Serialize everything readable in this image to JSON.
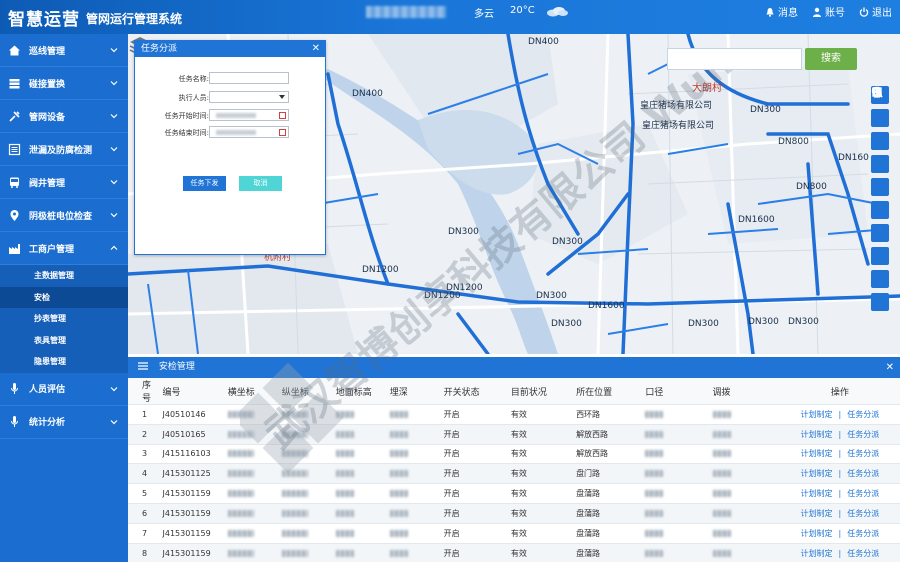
{
  "header": {
    "logo": "智慧运营",
    "subtitle": "管网运行管理系统",
    "weather": "多云",
    "temperature": "20°C",
    "messages": "消息",
    "account": "账号",
    "logout": "退出"
  },
  "sidebar": {
    "items": [
      {
        "label": "巡线管理",
        "icon": "home-icon"
      },
      {
        "label": "碰接置换",
        "icon": "stack-icon"
      },
      {
        "label": "管网设备",
        "icon": "tools-icon"
      },
      {
        "label": "泄漏及防腐检测",
        "icon": "list-icon"
      },
      {
        "label": "阀井管理",
        "icon": "bus-icon"
      },
      {
        "label": "阴极桩电位检查",
        "icon": "pin-icon"
      },
      {
        "label": "工商户管理",
        "icon": "factory-icon"
      }
    ],
    "sub_items": [
      "主数据管理",
      "安检",
      "抄表管理",
      "表具管理",
      "隐患管理"
    ],
    "bottom_items": [
      {
        "label": "人员评估",
        "icon": "mic-icon"
      },
      {
        "label": "统计分析",
        "icon": "mic-icon"
      }
    ]
  },
  "map": {
    "search_button": "搜索",
    "labels": [
      "DN400",
      "DN300",
      "DN300",
      "DN1200",
      "DN300",
      "DN1600",
      "DN300",
      "DN300",
      "DN300",
      "DN800",
      "DN300",
      "DN160",
      "DN800",
      "DN1600",
      "DN300",
      "DN1200",
      "DN400",
      "大朗村",
      "皇庄猪场有限公司",
      "皇庄猪场有限公司",
      "杭附村",
      "DN1200"
    ]
  },
  "dialog": {
    "title": "任务分派",
    "fields": {
      "name": "任务名称:",
      "executor": "执行人员:",
      "start": "任务开始时间:",
      "end": "任务结束时间:"
    },
    "submit": "任务下发",
    "cancel": "取消"
  },
  "panel": {
    "title": "安检管理",
    "columns": [
      "序号",
      "编号",
      "横坐标",
      "纵坐标",
      "地面标高",
      "埋深",
      "开关状态",
      "目前状况",
      "所在位置",
      "口径",
      "调拨",
      "操作"
    ],
    "rows": [
      {
        "no": "1",
        "code": "J40510146",
        "switch": "开启",
        "status": "有效",
        "location": "西环路"
      },
      {
        "no": "2",
        "code": "J40510165",
        "switch": "开启",
        "status": "有效",
        "location": "解放西路"
      },
      {
        "no": "3",
        "code": "J415116103",
        "switch": "开启",
        "status": "有效",
        "location": "解放西路"
      },
      {
        "no": "4",
        "code": "J415301125",
        "switch": "开启",
        "status": "有效",
        "location": "盘门路"
      },
      {
        "no": "5",
        "code": "J415301159",
        "switch": "开启",
        "status": "有效",
        "location": "盘蒲路"
      },
      {
        "no": "6",
        "code": "J415301159",
        "switch": "开启",
        "status": "有效",
        "location": "盘蒲路"
      },
      {
        "no": "7",
        "code": "J415301159",
        "switch": "开启",
        "status": "有效",
        "location": "盘蒲路"
      },
      {
        "no": "8",
        "code": "J415301159",
        "switch": "开启",
        "status": "有效",
        "location": "盘蒲路"
      }
    ],
    "action_plan": "计划制定",
    "action_assign": "任务分派"
  },
  "watermark": "武汉智博创享科技有限公司 Wuhan Zondy Technology Co., Ltd"
}
